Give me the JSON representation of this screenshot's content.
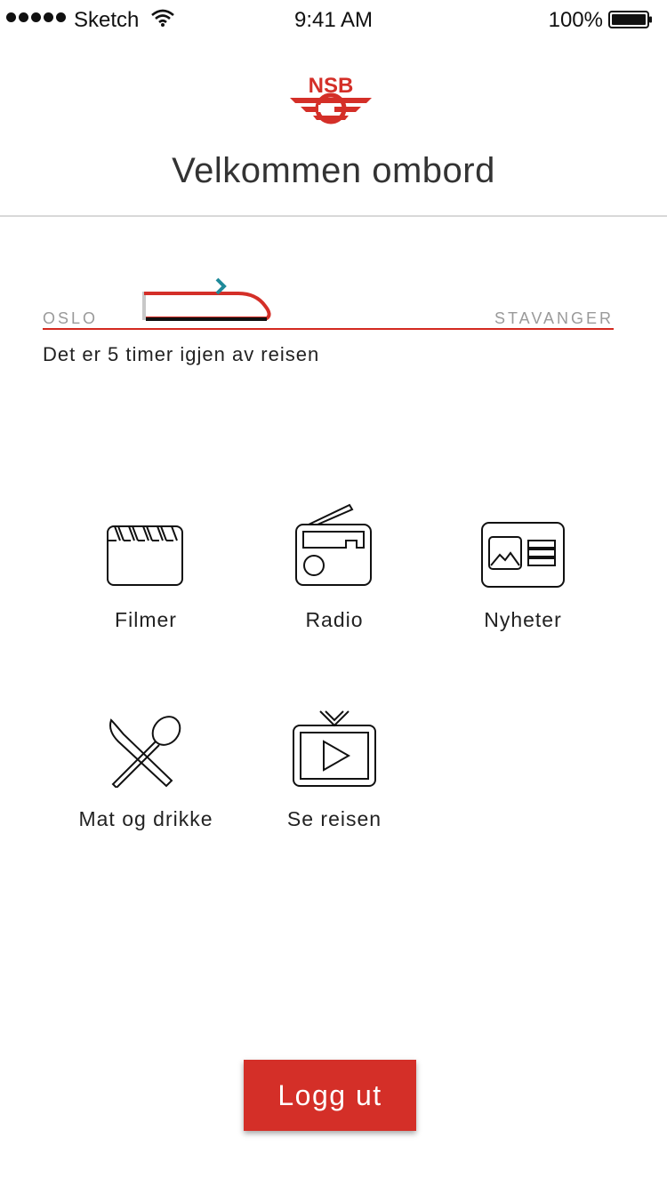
{
  "status_bar": {
    "carrier": "Sketch",
    "time": "9:41 AM",
    "battery": "100%"
  },
  "header": {
    "logo_text": "NSB",
    "title": "Velkommen ombord"
  },
  "journey": {
    "origin": "OSLO",
    "destination": "STAVANGER",
    "remaining_text": "Det er 5 timer igjen av reisen",
    "progress": 0.38
  },
  "menu": {
    "items": [
      {
        "label": "Filmer",
        "icon": "clapperboard-icon"
      },
      {
        "label": "Radio",
        "icon": "radio-icon"
      },
      {
        "label": "Nyheter",
        "icon": "newspaper-icon"
      },
      {
        "label": "Mat og drikke",
        "icon": "knife-spoon-icon"
      },
      {
        "label": "Se reisen",
        "icon": "tv-play-icon"
      }
    ]
  },
  "logout_label": "Logg ut",
  "colors": {
    "brand_red": "#d42f28",
    "train_accent": "#1f8a9a",
    "divider": "#d8d8d8"
  }
}
